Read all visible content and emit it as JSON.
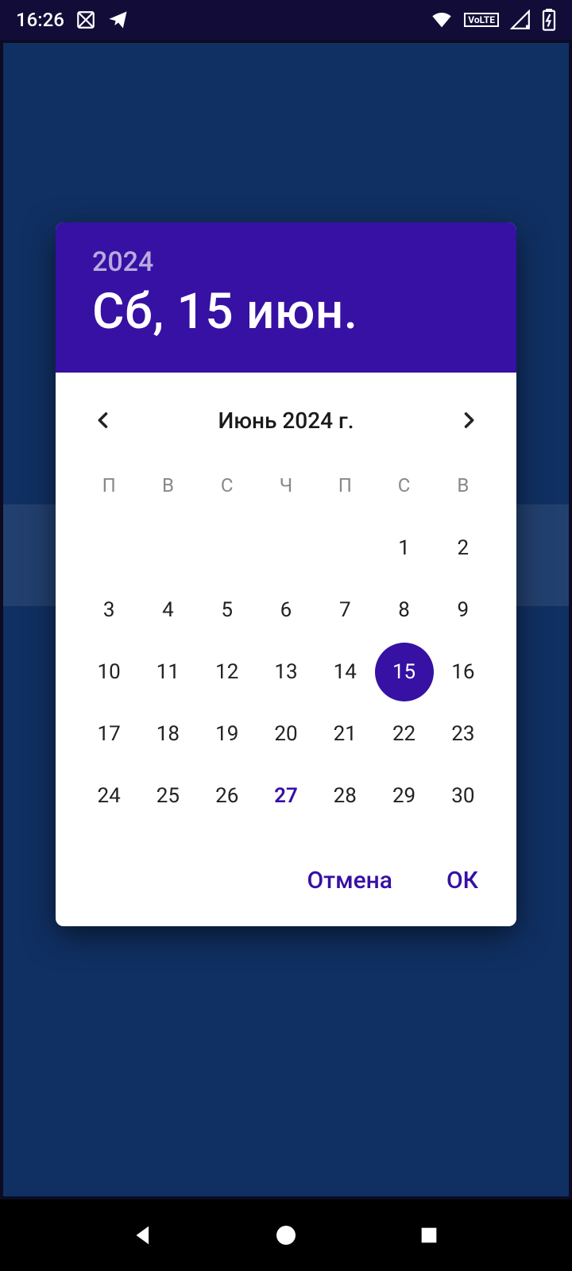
{
  "status_bar": {
    "time": "16:26",
    "volte_label": "VoLTE"
  },
  "dialog": {
    "year": "2024",
    "selected_label": "Сб, 15 июн.",
    "month_label": "Июнь 2024 г.",
    "weekdays": [
      "П",
      "В",
      "С",
      "Ч",
      "П",
      "С",
      "В"
    ],
    "leading_blanks": 5,
    "days": [
      1,
      2,
      3,
      4,
      5,
      6,
      7,
      8,
      9,
      10,
      11,
      12,
      13,
      14,
      15,
      16,
      17,
      18,
      19,
      20,
      21,
      22,
      23,
      24,
      25,
      26,
      27,
      28,
      29,
      30
    ],
    "selected_day": 15,
    "today_day": 27,
    "actions": {
      "cancel": "Отмена",
      "ok": "ОК"
    }
  },
  "colors": {
    "accent": "#3710a4",
    "app_bg": "#103063"
  }
}
